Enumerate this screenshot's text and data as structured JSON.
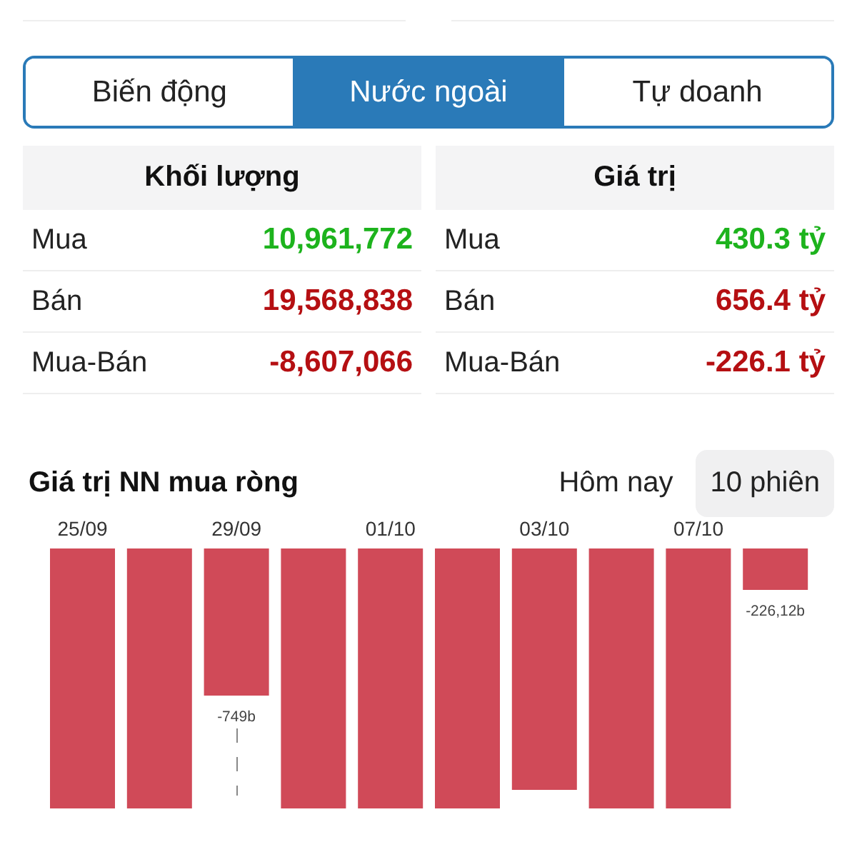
{
  "tabs": [
    {
      "label": "Biến động",
      "selected": false
    },
    {
      "label": "Nước ngoài",
      "selected": true
    },
    {
      "label": "Tự doanh",
      "selected": false
    }
  ],
  "tables": [
    {
      "title": "Khối lượng",
      "rows": [
        {
          "label": "Mua",
          "value": "10,961,772",
          "color": "#1db31d"
        },
        {
          "label": "Bán",
          "value": "19,568,838",
          "color": "#b50f12"
        },
        {
          "label": "Mua-Bán",
          "value": "-8,607,066",
          "color": "#b50f12"
        }
      ]
    },
    {
      "title": "Giá trị",
      "rows": [
        {
          "label": "Mua",
          "value": "430.3 tỷ",
          "color": "#1db31d"
        },
        {
          "label": "Bán",
          "value": "656.4 tỷ",
          "color": "#b50f12"
        },
        {
          "label": "Mua-Bán",
          "value": "-226.1 tỷ",
          "color": "#b50f12"
        }
      ]
    }
  ],
  "net_chart": {
    "title": "Giá trị NN mua ròng",
    "periods": [
      {
        "label": "Hôm nay",
        "selected": false
      },
      {
        "label": "10 phiên",
        "selected": true
      }
    ],
    "date_labels": [
      "25/09",
      "29/09",
      "01/10",
      "03/10",
      "07/10"
    ],
    "value_labels": [
      "-749b",
      "-226,12b"
    ]
  }
}
